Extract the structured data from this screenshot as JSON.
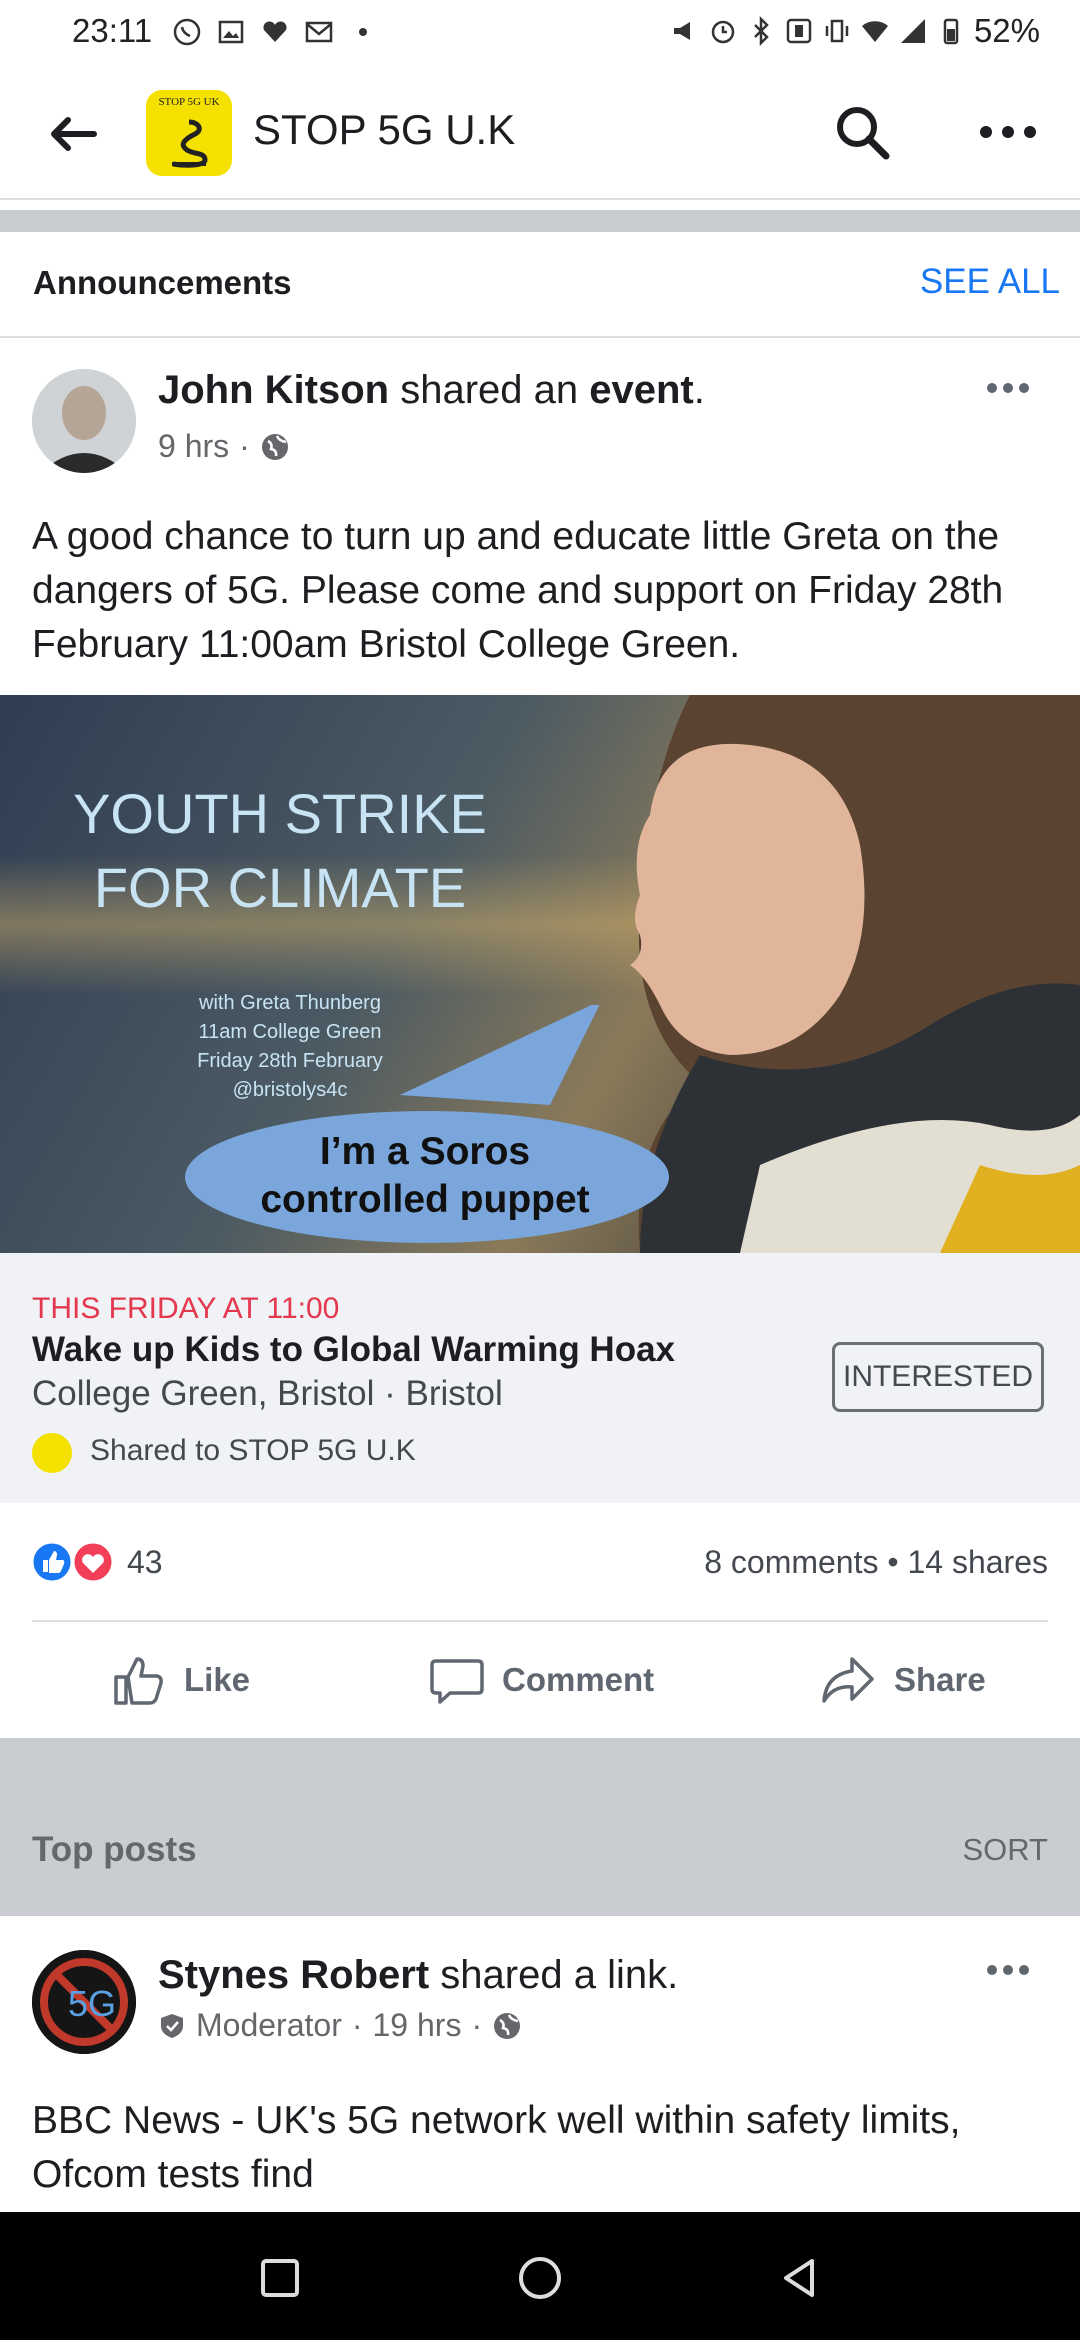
{
  "status_bar": {
    "time": "23:11",
    "battery": "52%"
  },
  "app_bar": {
    "title": "STOP 5G U.K",
    "logo_text": "STOP 5G UK"
  },
  "announcements": {
    "title": "Announcements",
    "see_all": "SEE ALL"
  },
  "post1": {
    "author": "John Kitson",
    "action_pre": " shared an ",
    "action_obj": "event",
    "action_post": ".",
    "time": "9 hrs",
    "text": "A good chance to turn up and educate little Greta on the dangers of 5G. Please come and support on Friday 28th February 11:00am Bristol College Green.",
    "image": {
      "headline1": "YOUTH STRIKE",
      "headline2": "FOR CLIMATE",
      "sub1": "with Greta Thunberg",
      "sub2": "11am College Green",
      "sub3": "Friday 28th February",
      "sub4": "@bristolys4c",
      "bubble1": "I’m a Soros",
      "bubble2": "controlled puppet"
    },
    "event": {
      "date": "THIS FRIDAY AT 11:00",
      "title": "Wake up Kids to Global Warming Hoax",
      "location": "College Green, Bristol · Bristol",
      "button": "INTERESTED",
      "shared_to": "Shared to STOP 5G U.K"
    },
    "reactions_count": "43",
    "stats": "8 comments • 14 shares",
    "actions": {
      "like": "Like",
      "comment": "Comment",
      "share": "Share"
    }
  },
  "top_posts": {
    "title": "Top posts",
    "sort": "SORT"
  },
  "post2": {
    "author": "Stynes Robert",
    "action": " shared a link.",
    "role": "Moderator",
    "time": "19 hrs",
    "text": "BBC News - UK's 5G network well within safety limits, Ofcom tests find"
  },
  "colors": {
    "accent": "#1877f2",
    "event_date": "#e4384f",
    "band": "#c9ccd1"
  }
}
